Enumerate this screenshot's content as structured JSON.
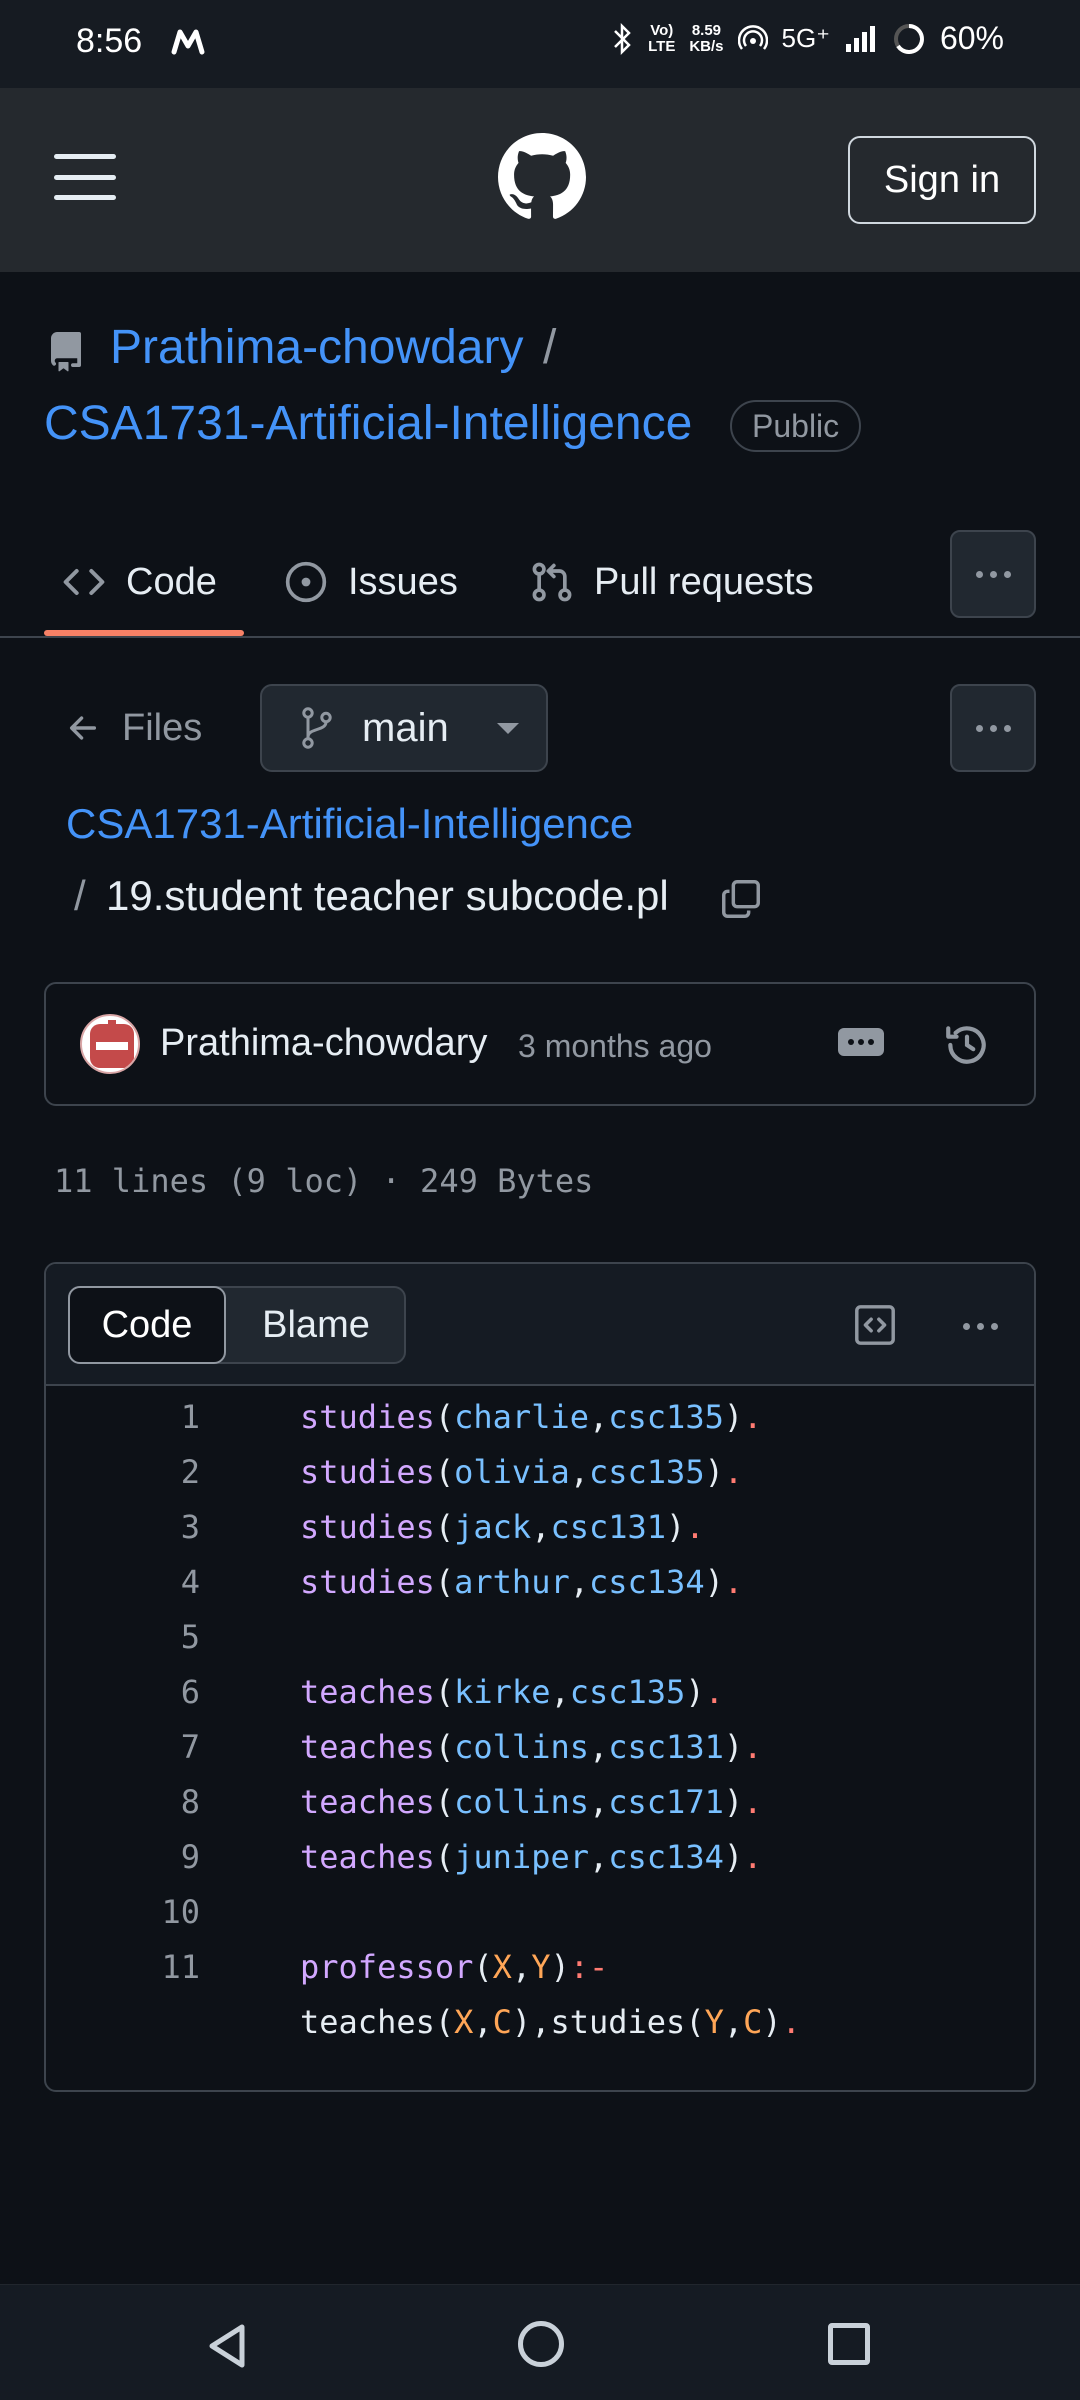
{
  "status_bar": {
    "time": "8:56",
    "volte": "Vo)\nLTE",
    "speed": "8.59\nKB/s",
    "network": "5G⁺",
    "battery": "60%"
  },
  "header": {
    "sign_in": "Sign in"
  },
  "repo": {
    "owner": "Prathima-chowdary",
    "slash": "/",
    "name": "CSA1731-Artificial-Intelligence",
    "visibility": "Public"
  },
  "tabs": [
    {
      "label": "Code",
      "icon": "code-icon",
      "active": true
    },
    {
      "label": "Issues",
      "icon": "issue-opened-icon"
    },
    {
      "label": "Pull requests",
      "icon": "git-pull-request-icon"
    }
  ],
  "files_bar": {
    "back_label": "Files",
    "branch": "main"
  },
  "breadcrumb": {
    "repo": "CSA1731-Artificial-Intelligence",
    "slash": "/",
    "file": "19.student teacher subcode.pl"
  },
  "commit": {
    "author": "Prathima-chowdary",
    "time": "3 months ago"
  },
  "file_meta": "11 lines (9 loc) · 249 Bytes",
  "code_view": {
    "tab_code": "Code",
    "tab_blame": "Blame",
    "lines": [
      {
        "n": "1",
        "tokens": [
          [
            "fn",
            "studies"
          ],
          [
            "pl",
            "("
          ],
          [
            "at",
            "charlie"
          ],
          [
            "pl",
            ","
          ],
          [
            "at",
            "csc135"
          ],
          [
            "pl",
            ")"
          ],
          [
            "op",
            "."
          ]
        ]
      },
      {
        "n": "2",
        "tokens": [
          [
            "fn",
            "studies"
          ],
          [
            "pl",
            "("
          ],
          [
            "at",
            "olivia"
          ],
          [
            "pl",
            ","
          ],
          [
            "at",
            "csc135"
          ],
          [
            "pl",
            ")"
          ],
          [
            "op",
            "."
          ]
        ]
      },
      {
        "n": "3",
        "tokens": [
          [
            "fn",
            "studies"
          ],
          [
            "pl",
            "("
          ],
          [
            "at",
            "jack"
          ],
          [
            "pl",
            ","
          ],
          [
            "at",
            "csc131"
          ],
          [
            "pl",
            ")"
          ],
          [
            "op",
            "."
          ]
        ]
      },
      {
        "n": "4",
        "tokens": [
          [
            "fn",
            "studies"
          ],
          [
            "pl",
            "("
          ],
          [
            "at",
            "arthur"
          ],
          [
            "pl",
            ","
          ],
          [
            "at",
            "csc134"
          ],
          [
            "pl",
            ")"
          ],
          [
            "op",
            "."
          ]
        ]
      },
      {
        "n": "5",
        "tokens": []
      },
      {
        "n": "6",
        "tokens": [
          [
            "fn",
            "teaches"
          ],
          [
            "pl",
            "("
          ],
          [
            "at",
            "kirke"
          ],
          [
            "pl",
            ","
          ],
          [
            "at",
            "csc135"
          ],
          [
            "pl",
            ")"
          ],
          [
            "op",
            "."
          ]
        ]
      },
      {
        "n": "7",
        "tokens": [
          [
            "fn",
            "teaches"
          ],
          [
            "pl",
            "("
          ],
          [
            "at",
            "collins"
          ],
          [
            "pl",
            ","
          ],
          [
            "at",
            "csc131"
          ],
          [
            "pl",
            ")"
          ],
          [
            "op",
            "."
          ]
        ]
      },
      {
        "n": "8",
        "tokens": [
          [
            "fn",
            "teaches"
          ],
          [
            "pl",
            "("
          ],
          [
            "at",
            "collins"
          ],
          [
            "pl",
            ","
          ],
          [
            "at",
            "csc171"
          ],
          [
            "pl",
            ")"
          ],
          [
            "op",
            "."
          ]
        ]
      },
      {
        "n": "9",
        "tokens": [
          [
            "fn",
            "teaches"
          ],
          [
            "pl",
            "("
          ],
          [
            "at",
            "juniper"
          ],
          [
            "pl",
            ","
          ],
          [
            "at",
            "csc134"
          ],
          [
            "pl",
            ")"
          ],
          [
            "op",
            "."
          ]
        ]
      },
      {
        "n": "10",
        "tokens": []
      },
      {
        "n": "11",
        "tokens": [
          [
            "fn",
            "professor"
          ],
          [
            "pl",
            "("
          ],
          [
            "vr",
            "X"
          ],
          [
            "pl",
            ","
          ],
          [
            "vr",
            "Y"
          ],
          [
            "pl",
            ")"
          ],
          [
            "op",
            ":-"
          ]
        ]
      },
      {
        "n": "",
        "tokens": [
          [
            "pl",
            "teaches("
          ],
          [
            "vr",
            "X"
          ],
          [
            "pl",
            ","
          ],
          [
            "vr",
            "C"
          ],
          [
            "pl",
            "),studies("
          ],
          [
            "vr",
            "Y"
          ],
          [
            "pl",
            ","
          ],
          [
            "vr",
            "C"
          ],
          [
            "pl",
            ")"
          ],
          [
            "op",
            "."
          ]
        ]
      }
    ]
  }
}
